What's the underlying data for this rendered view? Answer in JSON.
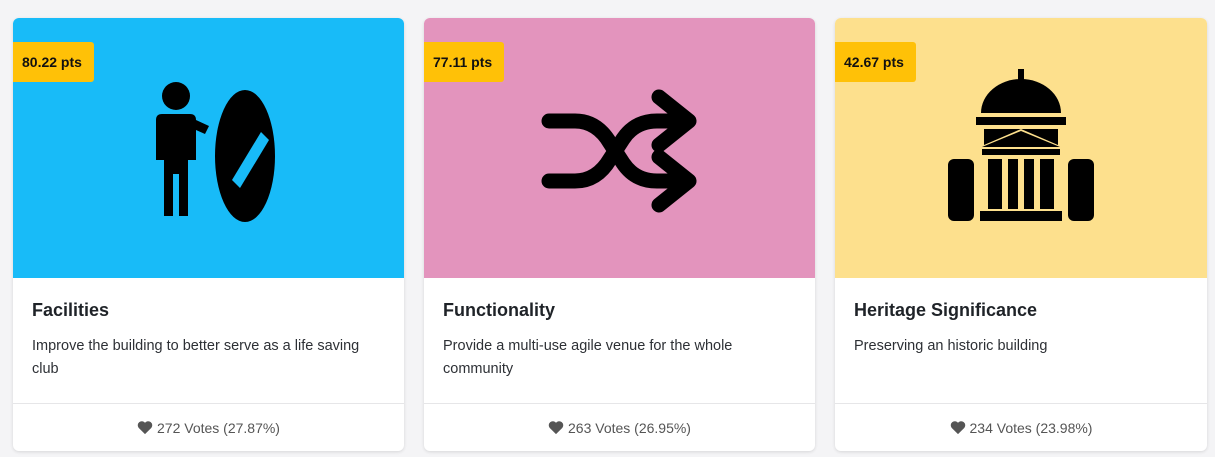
{
  "colors": {
    "card1_bg": "#18bbf8",
    "card2_bg": "#e394bd",
    "card3_bg": "#fde08d",
    "badge": "#ffc107"
  },
  "cards": [
    {
      "points": "80.22 pts",
      "icon": "surfer-icon",
      "title": "Facilities",
      "description": "Improve the building to better serve as a life saving club",
      "votes": "272 Votes (27.87%)"
    },
    {
      "points": "77.11 pts",
      "icon": "shuffle-icon",
      "title": "Functionality",
      "description": "Provide a multi-use agile venue for the whole community",
      "votes": "263 Votes (26.95%)"
    },
    {
      "points": "42.67 pts",
      "icon": "heritage-building-icon",
      "title": "Heritage Significance",
      "description": "Preserving an historic building",
      "votes": "234 Votes (23.98%)"
    }
  ]
}
